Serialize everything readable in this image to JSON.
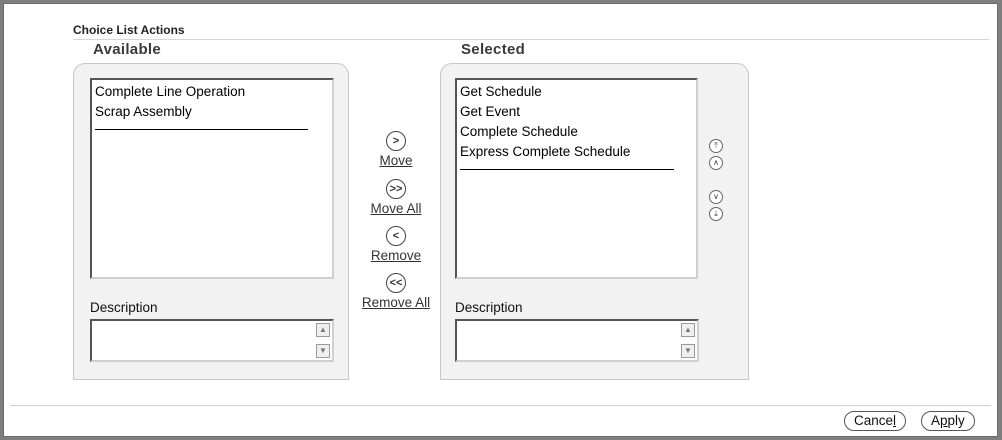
{
  "section": {
    "title": "Choice List Actions"
  },
  "available": {
    "heading": "Available",
    "items": [
      "Complete Line Operation",
      "Scrap Assembly"
    ],
    "description_label": "Description",
    "description_value": ""
  },
  "selected": {
    "heading": "Selected",
    "items": [
      "Get Schedule",
      "Get Event",
      "Complete Schedule",
      "Express Complete Schedule"
    ],
    "description_label": "Description",
    "description_value": ""
  },
  "shuttle": {
    "move_label": "Move",
    "move_all_label": "Move All",
    "remove_label": "Remove",
    "remove_all_label": "Remove All",
    "move_icon": "chevron-right-circle-icon",
    "move_all_icon": "double-chevron-right-circle-icon",
    "remove_icon": "chevron-left-circle-icon",
    "remove_all_icon": "double-chevron-left-circle-icon"
  },
  "reorder": {
    "top_icon": "move-to-top-icon",
    "up_icon": "move-up-icon",
    "down_icon": "move-down-icon",
    "bottom_icon": "move-to-bottom-icon"
  },
  "footer": {
    "cancel_label_before": "Cance",
    "cancel_label_access": "l",
    "apply_label_before": "A",
    "apply_label_access": "p",
    "apply_label_after": "ply"
  }
}
